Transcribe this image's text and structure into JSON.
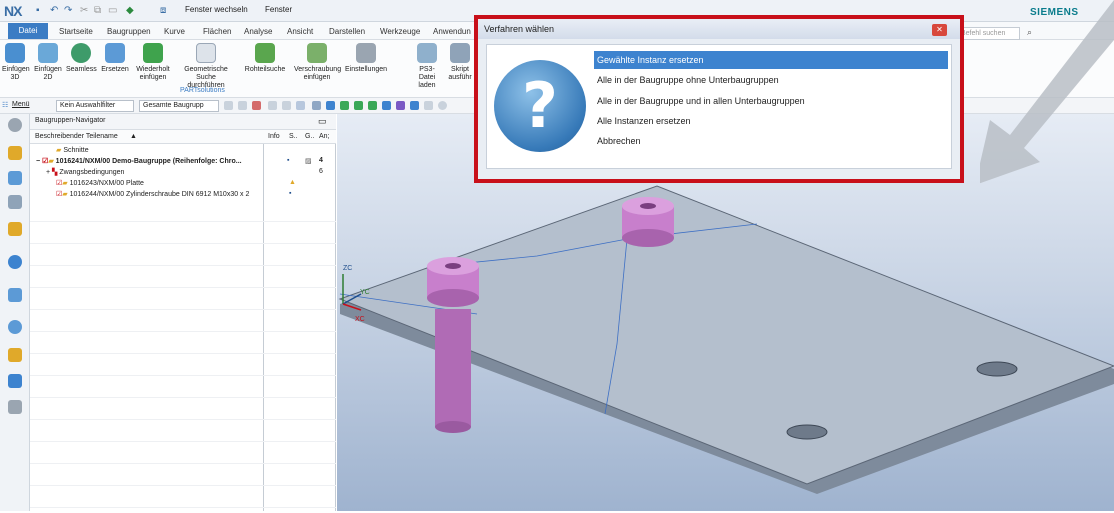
{
  "app": {
    "logo": "NX",
    "window_switch": "Fenster wechseln",
    "window_menu": "Fenster",
    "brand": "SIEMENS"
  },
  "menu": {
    "file": "Datei",
    "tabs": [
      "Startseite",
      "Baugruppen",
      "Kurve",
      "Flächen",
      "Analyse",
      "Ansicht",
      "Darstellen",
      "Werkzeuge",
      "Anwendun"
    ],
    "search_placeholder": "Befehl suchen"
  },
  "ribbon": {
    "buttons": [
      {
        "label": "Einfügen 3D"
      },
      {
        "label": "Einfügen 2D"
      },
      {
        "label": "Seamless"
      },
      {
        "label": "Ersetzen"
      },
      {
        "label": "Wiederholt einfügen"
      },
      {
        "label": "Geometrische Suche durchführen"
      },
      {
        "label": "Rohteilsuche"
      },
      {
        "label": "Verschraubung einfügen"
      },
      {
        "label": "Einstellungen"
      },
      {
        "label": "PS3-Datei laden"
      },
      {
        "label": "Skript ausführ"
      }
    ],
    "group": "PARTsolutions"
  },
  "toolbar": {
    "menu": "Menü",
    "filter": "Kein Auswahlfilter",
    "scope": "Gesamte Baugrupp"
  },
  "navigator": {
    "title": "Baugruppen-Navigator",
    "columns": [
      "Beschreibender Teilename",
      "Info",
      "S..",
      "G..",
      "An;"
    ],
    "rows": [
      {
        "name": "Schnitte",
        "count": ""
      },
      {
        "name": "1016241/NXM/00 Demo-Baugruppe (Reihenfolge: Chro...",
        "count": "4"
      },
      {
        "name": "Zwangsbedingungen",
        "count": "6"
      },
      {
        "name": "1016243/NXM/00 Platte",
        "count": ""
      },
      {
        "name": "1016244/NXM/00 Zylinderschraube DIN 6912 M10x30 x 2",
        "count": ""
      }
    ]
  },
  "viewport": {
    "axis_zc": "ZC",
    "axis_yc": "YC",
    "axis_xc": "XC"
  },
  "dialog": {
    "title": "Verfahren wählen",
    "options": [
      "Gewählte Instanz ersetzen",
      "Alle in der Baugruppe ohne Unterbaugruppen",
      "Alle in der Baugruppe und in allen Unterbaugruppen",
      "Alle Instanzen ersetzen",
      "Abbrechen"
    ]
  },
  "colors": {
    "accent": "#3b7cc4",
    "highlight": "#c8101a",
    "part": "#c87fcc"
  }
}
